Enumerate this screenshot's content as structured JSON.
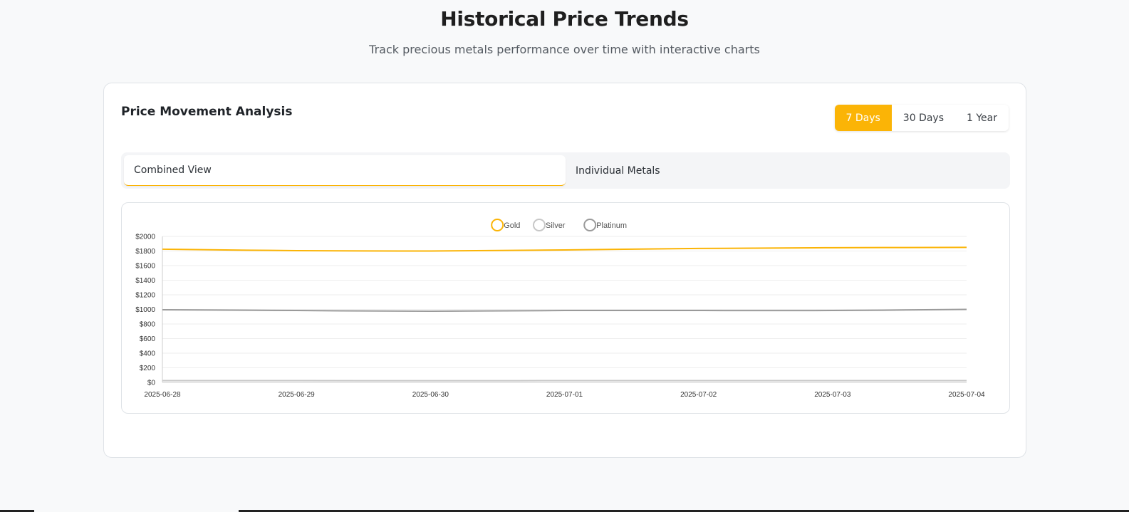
{
  "header": {
    "title": "Historical Price Trends",
    "subtitle": "Track precious metals performance over time with interactive charts"
  },
  "card": {
    "title": "Price Movement Analysis",
    "ranges": [
      {
        "label": "7 Days",
        "active": true
      },
      {
        "label": "30 Days",
        "active": false
      },
      {
        "label": "1 Year",
        "active": false
      }
    ],
    "view_tabs": [
      {
        "label": "Combined View",
        "active": true
      },
      {
        "label": "Individual Metals",
        "active": false
      }
    ]
  },
  "colors": {
    "accent": "#fbb406",
    "gold": "#fbb406",
    "silver": "#c7c7c7",
    "platinum": "#9a9a9a"
  },
  "chart_data": {
    "type": "line",
    "x": [
      "2025-06-28",
      "2025-06-29",
      "2025-06-30",
      "2025-07-01",
      "2025-07-02",
      "2025-07-03",
      "2025-07-04"
    ],
    "series": [
      {
        "name": "Gold",
        "color": "#fbb406",
        "values": [
          1825,
          1805,
          1800,
          1815,
          1835,
          1845,
          1850
        ]
      },
      {
        "name": "Silver",
        "color": "#c7c7c7",
        "values": [
          24,
          24,
          23,
          24,
          24,
          24,
          25
        ]
      },
      {
        "name": "Platinum",
        "color": "#9a9a9a",
        "values": [
          995,
          985,
          975,
          985,
          985,
          985,
          1000
        ]
      }
    ],
    "yticks": [
      "$0",
      "$200",
      "$400",
      "$600",
      "$800",
      "$1000",
      "$1200",
      "$1400",
      "$1600",
      "$1800",
      "$2000"
    ],
    "ylim": [
      0,
      2000
    ],
    "grid": true,
    "legend": "top-center"
  }
}
